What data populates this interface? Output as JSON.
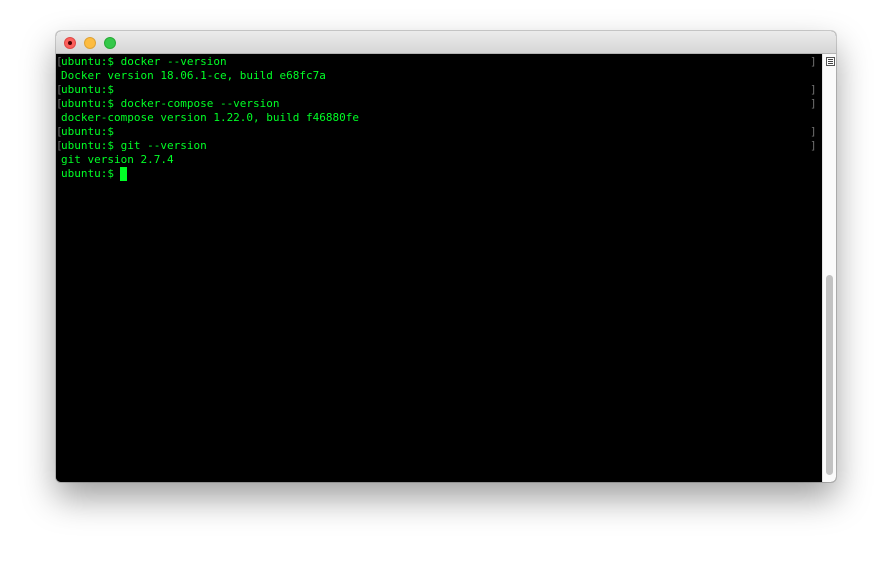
{
  "window": {
    "buttons": {
      "close": "close-button",
      "minimize": "minimize-button",
      "zoom": "zoom-button"
    }
  },
  "terminal": {
    "lines": [
      {
        "text": "ubuntu:$ docker --version",
        "marked": true
      },
      {
        "text": "Docker version 18.06.1-ce, build e68fc7a",
        "marked": false
      },
      {
        "text": "ubuntu:$",
        "marked": true
      },
      {
        "text": "ubuntu:$ docker-compose --version",
        "marked": true
      },
      {
        "text": "docker-compose version 1.22.0, build f46880fe",
        "marked": false
      },
      {
        "text": "ubuntu:$",
        "marked": true
      },
      {
        "text": "ubuntu:$ git --version",
        "marked": true
      },
      {
        "text": "git version 2.7.4",
        "marked": false
      },
      {
        "text": "ubuntu:$",
        "marked": false,
        "cursor": true
      }
    ],
    "mark_left": "[",
    "mark_right": "]",
    "text_color": "#00ff26",
    "background_color": "#000000"
  },
  "scrollbar": {
    "icon": "list-icon"
  }
}
